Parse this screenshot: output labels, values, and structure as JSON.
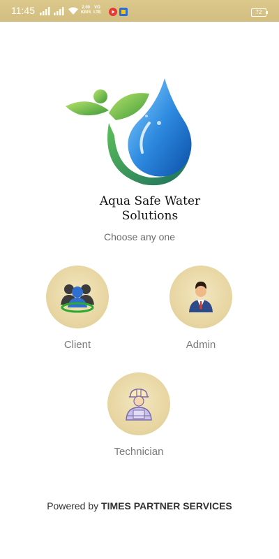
{
  "status_bar": {
    "time": "11:45",
    "speed": "2.00",
    "speed_unit": "KB/S",
    "volte_top": "VO",
    "volte_bottom": "LTE",
    "battery": "72",
    "icons": [
      "signal-icon",
      "signal-icon",
      "wifi-icon",
      "youtube-icon",
      "app-notification-icon"
    ]
  },
  "brand": {
    "title_line1": "Aqua Safe Water",
    "title_line2": "Solutions"
  },
  "prompt": "Choose any one",
  "roles": {
    "client": {
      "label": "Client",
      "icon": "users-group-icon"
    },
    "admin": {
      "label": "Admin",
      "icon": "businessman-icon"
    },
    "technician": {
      "label": "Technician",
      "icon": "worker-helmet-icon"
    }
  },
  "footer": {
    "prefix": "Powered by ",
    "company": "TIMES PARTNER SERVICES"
  },
  "colors": {
    "status_bar": "#d8c486",
    "role_circle": "#e9d8a6",
    "drop_blue": "#1e74c9",
    "leaf_green": "#6cc04a"
  }
}
